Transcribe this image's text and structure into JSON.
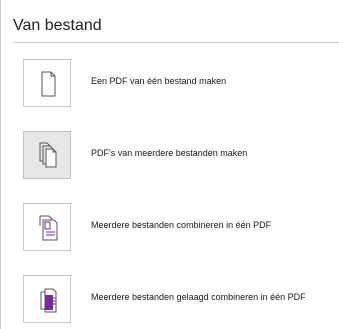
{
  "section": {
    "title": "Van bestand"
  },
  "items": [
    {
      "label": "Een PDF van één bestand maken",
      "icon": "single-page-icon",
      "selected": false
    },
    {
      "label": "PDF's van meerdere bestanden maken",
      "icon": "multiple-pages-icon",
      "selected": true
    },
    {
      "label": "Meerdere bestanden combineren in één PDF",
      "icon": "combine-files-icon",
      "selected": false
    },
    {
      "label": "Meerdere bestanden gelaagd combineren in één PDF",
      "icon": "layered-combine-icon",
      "selected": false
    }
  ],
  "colors": {
    "accent_purple": "#7a2a9a",
    "tile_border": "#c8c8c8",
    "selected_bg": "#e6e6e6"
  }
}
